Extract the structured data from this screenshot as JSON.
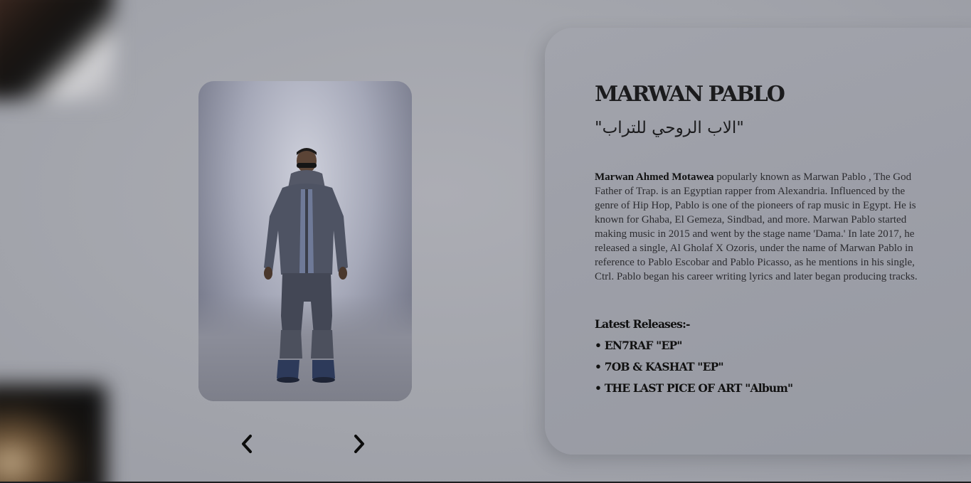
{
  "artist": {
    "name": "MARWAN PABLO",
    "nickname": "\"الاب الروحي للتراب\"",
    "bio_name": "Marwan Ahmed Motawea",
    "bio_text": " popularly known as Marwan Pablo , The God Father of Trap. is an Egyptian rapper from Alexandria. Influenced by the genre of Hip Hop, Pablo is one of the pioneers of rap music in Egypt. He is known for Ghaba, El Gemeza, Sindbad, and more. Marwan Pablo started making music in 2015 and went by the stage name 'Dama.' In late 2017, he released a single, Al Gholaf X Ozoris, under the name of Marwan Pablo in reference to Pablo Escobar and Pablo Picasso, as he mentions in his single, Ctrl. Pablo began his career writing lyrics and later began producing tracks."
  },
  "releases": {
    "title": "Latest Releases:-",
    "items": [
      {
        "label": "• EN7RAF \"EP\""
      },
      {
        "label": "• 7OB & KASHAT \"EP\""
      },
      {
        "label": "• THE LAST PICE OF ART \"Album\""
      }
    ]
  },
  "carousel": {
    "prev_icon": "chevron-left-icon",
    "next_icon": "chevron-right-icon"
  },
  "colors": {
    "background": "#a6a8af",
    "panel": "#9c9ea7",
    "text": "#111111"
  }
}
